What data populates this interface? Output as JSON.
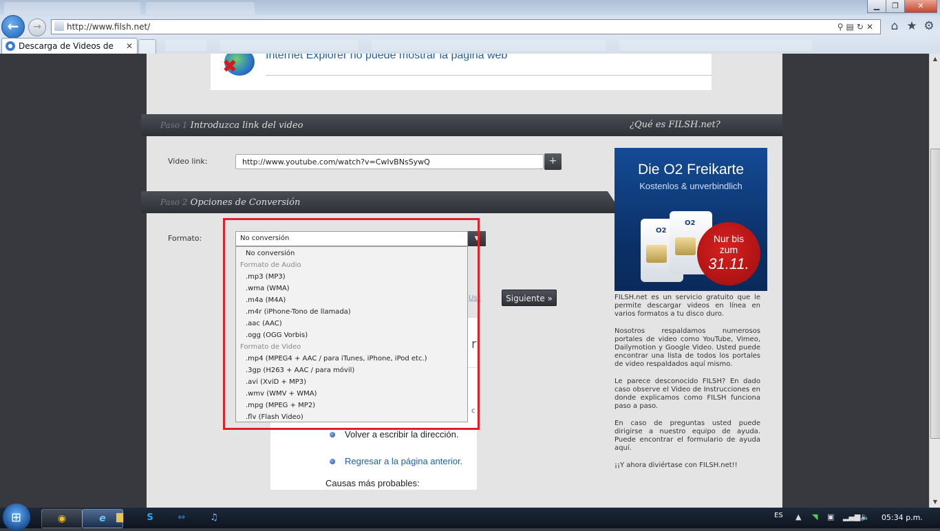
{
  "browser": {
    "address": "http://www.filsh.net/",
    "tab_title": "Descarga de Videos de You...",
    "tab_close": "✕",
    "window_controls": {
      "minimize": "▁",
      "maximize": "❐",
      "close": "✕"
    },
    "toolbar_icons": [
      "home-icon",
      "star-icon",
      "gear-icon"
    ]
  },
  "page": {
    "error_title": "Internet Explorer no puede mostrar la página web",
    "step1": {
      "prefix": "Paso 1",
      "title": "Introduzca link del video"
    },
    "what_is": "¿Qué es FILSH.net?",
    "step2": {
      "prefix": "Paso 2",
      "title": "Opciones de Conversión"
    },
    "video_link_label": "Video link:",
    "video_link_value": "http://www.youtube.com/watch?v=CwIvBNsSywQ",
    "plus_label": "+",
    "format_label": "Formato:",
    "format_selected": "No conversión",
    "usc_text": "Usc",
    "next_button": "Siguiente »",
    "format_options": [
      {
        "label": "No conversión",
        "kind": "option"
      },
      {
        "label": "Formato de Audio",
        "kind": "group"
      },
      {
        "label": ".mp3 (MP3)",
        "kind": "option"
      },
      {
        "label": ".wma (WMA)",
        "kind": "option"
      },
      {
        "label": ".m4a (M4A)",
        "kind": "option"
      },
      {
        "label": ".m4r (iPhone-Tono de llamada)",
        "kind": "option"
      },
      {
        "label": ".aac (AAC)",
        "kind": "option"
      },
      {
        "label": ".ogg (OGG Vorbis)",
        "kind": "option"
      },
      {
        "label": "Formato de Video",
        "kind": "group"
      },
      {
        "label": ".mp4 (MPEG4 + AAC / para iTunes, iPhone, iPod etc.)",
        "kind": "option"
      },
      {
        "label": ".3gp (H263 + AAC / para móvil)",
        "kind": "option"
      },
      {
        "label": ".avi (XviD + MP3)",
        "kind": "option"
      },
      {
        "label": ".wmv (WMV + WMA)",
        "kind": "option"
      },
      {
        "label": ".mpg (MPEG + MP2)",
        "kind": "option"
      },
      {
        "label": ".flv (Flash Video)",
        "kind": "option"
      }
    ],
    "error_frame": {
      "partial_r": "r",
      "partial_c": "c",
      "items": [
        "Volver a escribir la dirección.",
        "Regresar a la página anterior."
      ],
      "causes": "Causas más probables:"
    },
    "ad": {
      "title": "Die O2 Freikarte",
      "subtitle": "Kostenlos & unverbindlich",
      "sim_label": "O2",
      "badge_line1": "Nur bis",
      "badge_line2": "zum",
      "badge_date": "31.11."
    },
    "sidebar_paragraphs": [
      "FILSH.net es un servicio gratuito que le permite descargar videos en línea en varios formatos a tu disco duro.",
      "Nosotros respaldamos numerosos portales de video como YouTube, Vimeo, Dailymotion y Google Video. Usted puede encontrar una lista de todos los portales de video respaldados aquí mismo.",
      "Le parece desconocido FILSH? En dado caso observe el Video de Instrucciones en donde explicamos como FILSH funciona paso a paso.",
      "En caso de preguntas usted puede dirigirse a nuestro equipo de ayuda. Puede encontrar el formulario de ayuda aquí.",
      "¡¡Y ahora diviértase con FILSH.net!!"
    ]
  },
  "taskbar": {
    "language": "ES",
    "time": "05:34 p.m.",
    "pinned": [
      "chrome-icon",
      "ie-icon",
      "folder-icon",
      "skype-icon",
      "teamviewer-icon",
      "itunes-icon"
    ]
  },
  "colors": {
    "highlight": "#e01f2a",
    "link": "#1f5fa6",
    "ribbon": "#2e3036"
  }
}
